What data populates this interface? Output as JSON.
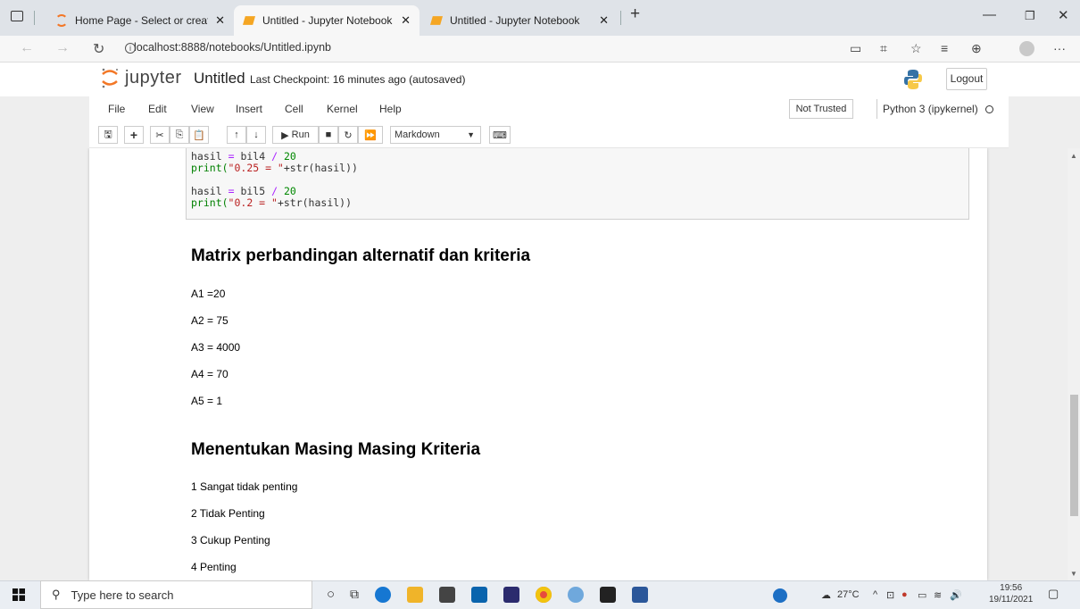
{
  "browser": {
    "tabs": [
      {
        "title": "Home Page - Select or create a n"
      },
      {
        "title": "Untitled - Jupyter Notebook"
      },
      {
        "title": "Untitled - Jupyter Notebook"
      }
    ],
    "url": "localhost:8888/notebooks/Untitled.ipynb"
  },
  "jupyter": {
    "logo_text": "jupyter",
    "notebook_name": "Untitled",
    "checkpoint": "Last Checkpoint: 16 minutes ago  (autosaved)",
    "logout": "Logout",
    "menu": [
      "File",
      "Edit",
      "View",
      "Insert",
      "Cell",
      "Kernel",
      "Help"
    ],
    "trust": "Not Trusted",
    "kernel": "Python 3 (ipykernel)",
    "toolbar": {
      "run": "Run",
      "cell_type": "Markdown"
    }
  },
  "cells": {
    "code": [
      {
        "var": "hasil",
        "op": "=",
        "var2": "bil4",
        "op2": "/",
        "num": "20",
        "call": "print(",
        "str": "\"0.25 = \"",
        "rest": "+str(hasil))"
      },
      {
        "var": "hasil",
        "op": "=",
        "var2": "bil5",
        "op2": "/",
        "num": "20",
        "call": "print(",
        "str": "\"0.2 = \"",
        "rest": "+str(hasil))"
      }
    ],
    "heading1": "Matrix perbandingan alternatif dan kriteria",
    "alternatives": [
      "A1 =20",
      "A2 = 75",
      "A3 = 4000",
      "A4 = 70",
      "A5 = 1"
    ],
    "heading2": "Menentukan Masing Masing Kriteria",
    "criteria": [
      "1 Sangat tidak penting",
      "2 Tidak Penting",
      "3 Cukup Penting",
      "4 Penting"
    ]
  },
  "taskbar": {
    "search_placeholder": "Type here to search",
    "weather": "27°C",
    "time": "19:56",
    "date": "19/11/2021"
  },
  "colors": {
    "jupyter_orange": "#f37726",
    "code_bg": "#f7f7f7",
    "taskbar": "#eaeef3"
  }
}
